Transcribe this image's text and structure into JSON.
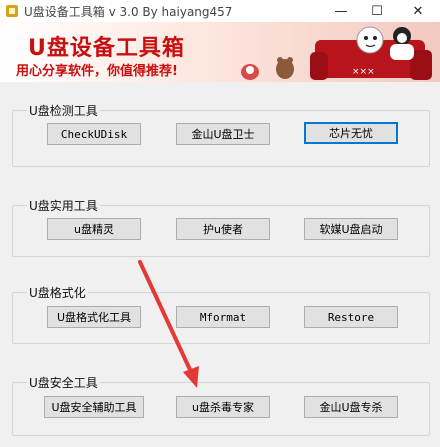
{
  "window": {
    "title": "U盘设备工具箱 v  3.0  By haiyang457",
    "controls": {
      "minimize": "—",
      "maximize": "☐",
      "close": "✕"
    }
  },
  "banner": {
    "title": "U盘设备工具箱",
    "slogan": "用心分享软件，你值得推荐!"
  },
  "groups": [
    {
      "label": "U盘检测工具",
      "buttons": [
        "CheckUDisk",
        "金山U盘卫士",
        "芯片无忧"
      ]
    },
    {
      "label": "U盘实用工具",
      "buttons": [
        "u盘精灵",
        "护u使者",
        "软媒U盘启动"
      ]
    },
    {
      "label": "U盘格式化",
      "buttons": [
        "U盘格式化工具",
        "Mformat",
        "Restore"
      ]
    },
    {
      "label": "U盘安全工具",
      "buttons": [
        "U盘安全辅助工具",
        "u盘杀毒专家",
        "金山U盘专杀"
      ]
    }
  ],
  "colors": {
    "accent_red": "#c81010",
    "annotation_arrow": "#e53935",
    "focus_blue": "#0078d7"
  }
}
